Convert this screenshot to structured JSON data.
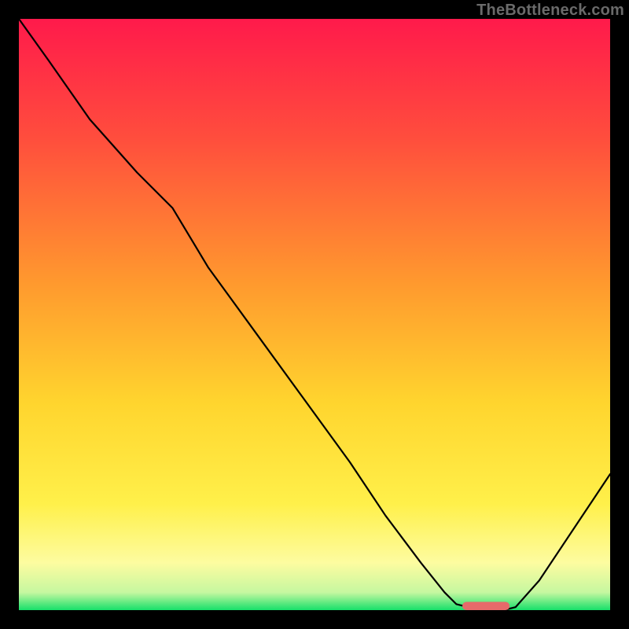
{
  "watermark": "TheBottleneck.com",
  "chart_data": {
    "type": "line",
    "title": "",
    "xlabel": "",
    "ylabel": "",
    "xlim": [
      0,
      100
    ],
    "ylim": [
      0,
      100
    ],
    "grid": false,
    "legend": false,
    "gradient_stops": [
      {
        "offset": 0.0,
        "color": "#ff1a4b"
      },
      {
        "offset": 0.2,
        "color": "#ff4d3d"
      },
      {
        "offset": 0.45,
        "color": "#ff9a2e"
      },
      {
        "offset": 0.65,
        "color": "#ffd52e"
      },
      {
        "offset": 0.82,
        "color": "#fff04a"
      },
      {
        "offset": 0.92,
        "color": "#fdfca0"
      },
      {
        "offset": 0.97,
        "color": "#c6f7a0"
      },
      {
        "offset": 1.0,
        "color": "#16e06a"
      }
    ],
    "series": [
      {
        "name": "bottleneck-curve",
        "color": "#000000",
        "stroke_width": 2.2,
        "x": [
          0,
          5,
          12,
          20,
          26,
          32,
          40,
          48,
          56,
          62,
          68,
          72,
          74,
          78,
          82,
          84,
          88,
          92,
          96,
          100
        ],
        "values": [
          100,
          93,
          83,
          74,
          68,
          58,
          47,
          36,
          25,
          16,
          8,
          3,
          1,
          0,
          0,
          0.5,
          5,
          11,
          17,
          23
        ]
      }
    ],
    "marker": {
      "name": "optimal-range",
      "color": "#e66a6a",
      "x_start": 75,
      "x_end": 83,
      "y": 0,
      "height": 1.4
    }
  }
}
